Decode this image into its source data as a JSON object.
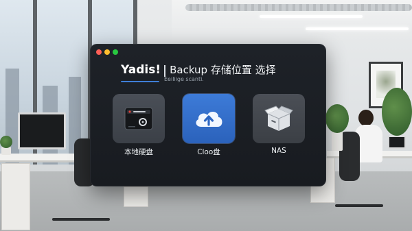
{
  "dialog": {
    "brand": "Yadis!",
    "title": "Backup 存储位置 选择",
    "subtitle": "Eeiliige scanti."
  },
  "options": [
    {
      "id": "local",
      "label": "本地硬盘",
      "icon": "hard-drive-icon"
    },
    {
      "id": "cloud",
      "label": "Cloo盘",
      "icon": "cloud-upload-icon",
      "selected": true
    },
    {
      "id": "nas",
      "label": "NAS",
      "icon": "nas-box-icon"
    }
  ],
  "colors": {
    "window_bg": "#1b1e23",
    "accent": "#3f7fd8",
    "selected_tile": "#3470c9",
    "tile": "#42474f"
  }
}
